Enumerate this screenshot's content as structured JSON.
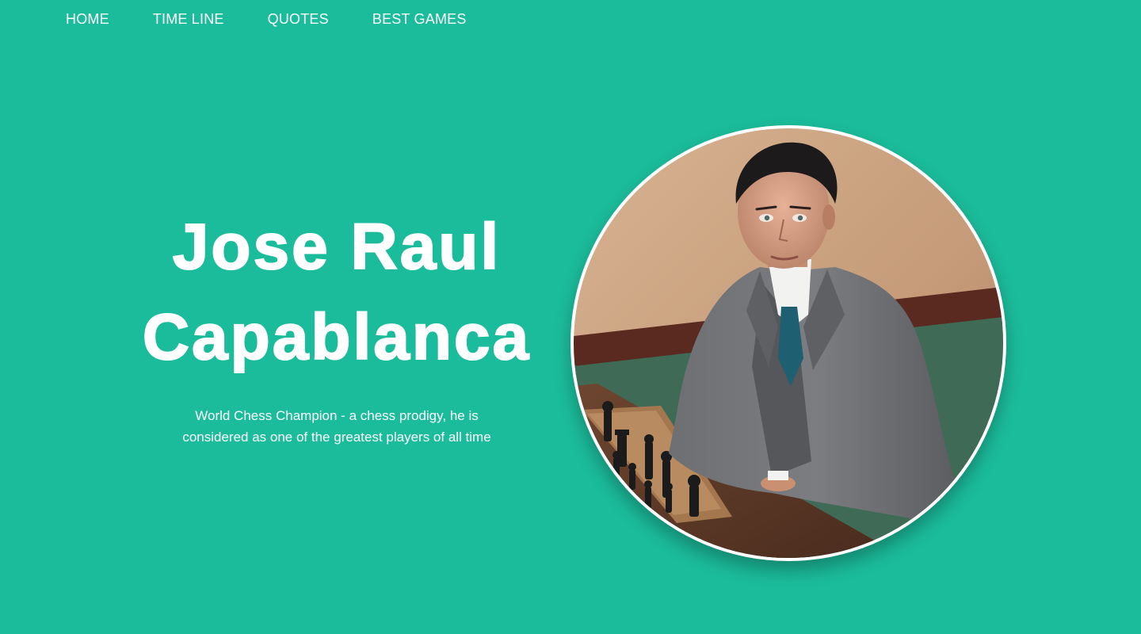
{
  "nav": {
    "items": [
      {
        "label": "HOME"
      },
      {
        "label": "TIME LINE"
      },
      {
        "label": "QUOTES"
      },
      {
        "label": "BEST GAMES"
      }
    ]
  },
  "hero": {
    "title_line1": "Jose Raul",
    "title_line2": "Capablanca",
    "subtitle": "World Chess Champion - a chess prodigy, he is considered as one of the greatest players of all time"
  },
  "portrait": {
    "subject": "chess player seated at a chessboard"
  },
  "colors": {
    "background": "#1bbc9b",
    "text": "#ffffff"
  }
}
